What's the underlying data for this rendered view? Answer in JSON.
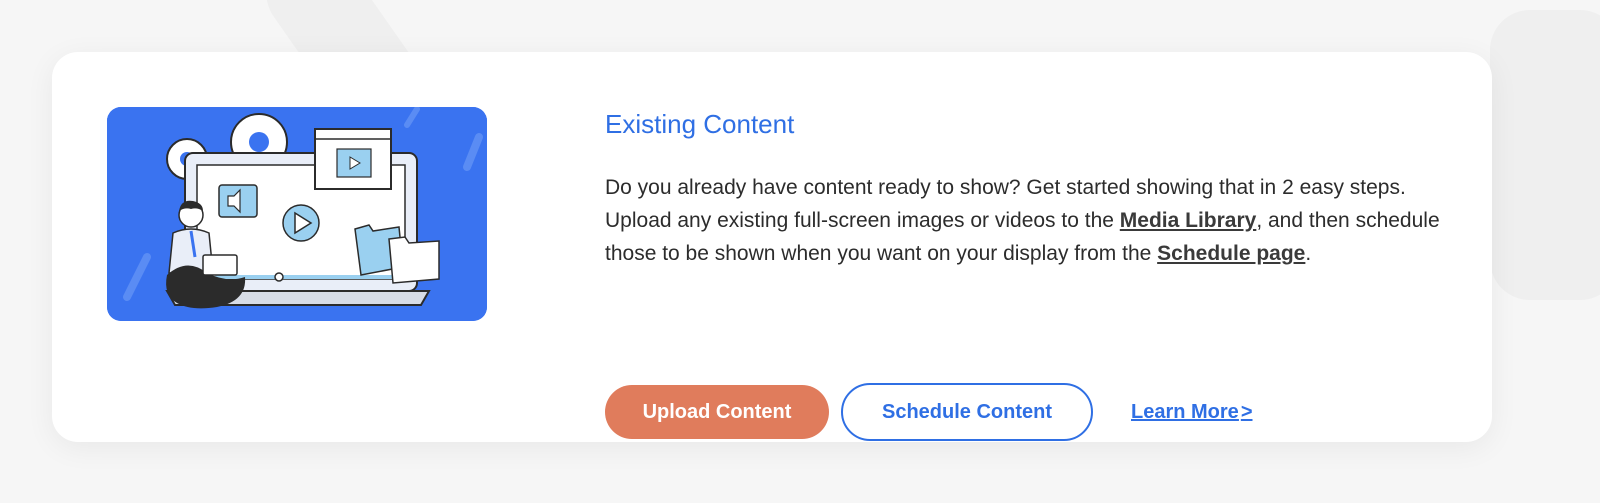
{
  "card": {
    "title": "Existing Content",
    "description": {
      "part1": "Do you already have content ready to show? Get started showing that in 2 easy steps. Upload any existing full-screen images or videos to the ",
      "media_library_link": "Media Library",
      "part2": ", and then schedule those to be shown when you want on your display from the ",
      "schedule_page_link": "Schedule page",
      "part3": "."
    },
    "buttons": {
      "upload": "Upload Content",
      "schedule": "Schedule Content",
      "learn_more": "Learn More",
      "learn_more_chevron": ">"
    },
    "illustration_icon": "person-with-laptop-media-illustration"
  },
  "colors": {
    "accent_blue": "#2f6fe4",
    "upload_orange": "#e07c5c",
    "illustration_bg": "#3a73f0"
  }
}
